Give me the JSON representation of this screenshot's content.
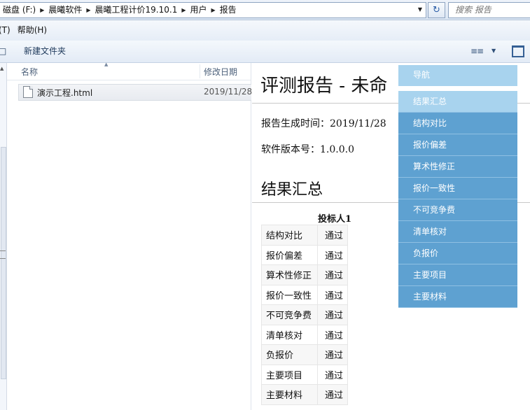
{
  "address_bar": {
    "crumbs": [
      "磁盘 (F:)",
      "晨曦软件",
      "晨曦工程计价19.10.1",
      "用户",
      "报告"
    ],
    "search_placeholder": "搜索 报告"
  },
  "menu_bar": {
    "items": [
      "(T)",
      "帮助(H)"
    ]
  },
  "command_bar": {
    "fragment": "□",
    "new_folder": "新建文件夹"
  },
  "file_list": {
    "columns": {
      "name": "名称",
      "date_modified": "修改日期"
    },
    "files": [
      {
        "name": "演示工程.html",
        "date_modified": "2019/11/28"
      }
    ]
  },
  "report": {
    "title": "评测报告 - 未命",
    "generated_label": "报告生成时间：",
    "generated_value": "2019/11/28",
    "version_label": "软件版本号：",
    "version_value": "1.0.0.0",
    "section_title": "结果汇总",
    "bidder_header": "投标人1",
    "rows": [
      {
        "item": "结构对比",
        "result": "通过"
      },
      {
        "item": "报价偏差",
        "result": "通过"
      },
      {
        "item": "算术性修正",
        "result": "通过"
      },
      {
        "item": "报价一致性",
        "result": "通过"
      },
      {
        "item": "不可竞争费",
        "result": "通过"
      },
      {
        "item": "清单核对",
        "result": "通过"
      },
      {
        "item": "负报价",
        "result": "通过"
      },
      {
        "item": "主要项目",
        "result": "通过"
      },
      {
        "item": "主要材料",
        "result": "通过"
      }
    ]
  },
  "nav_overlay": {
    "header": "导航",
    "items": [
      "结果汇总",
      "结构对比",
      "报价偏差",
      "算术性修正",
      "报价一致性",
      "不可竞争费",
      "清单核对",
      "负报价",
      "主要项目",
      "主要材料"
    ],
    "active_index": 0
  },
  "colors": {
    "nav_item_bg": "#5ea1d1",
    "nav_active_bg": "#a8d3ee",
    "explorer_chrome": "#dbe6f4"
  },
  "icons": {
    "refresh": "refresh-icon",
    "view_menu": "view-options-icon",
    "preview_pane": "preview-pane-icon",
    "file": "html-file-icon"
  }
}
